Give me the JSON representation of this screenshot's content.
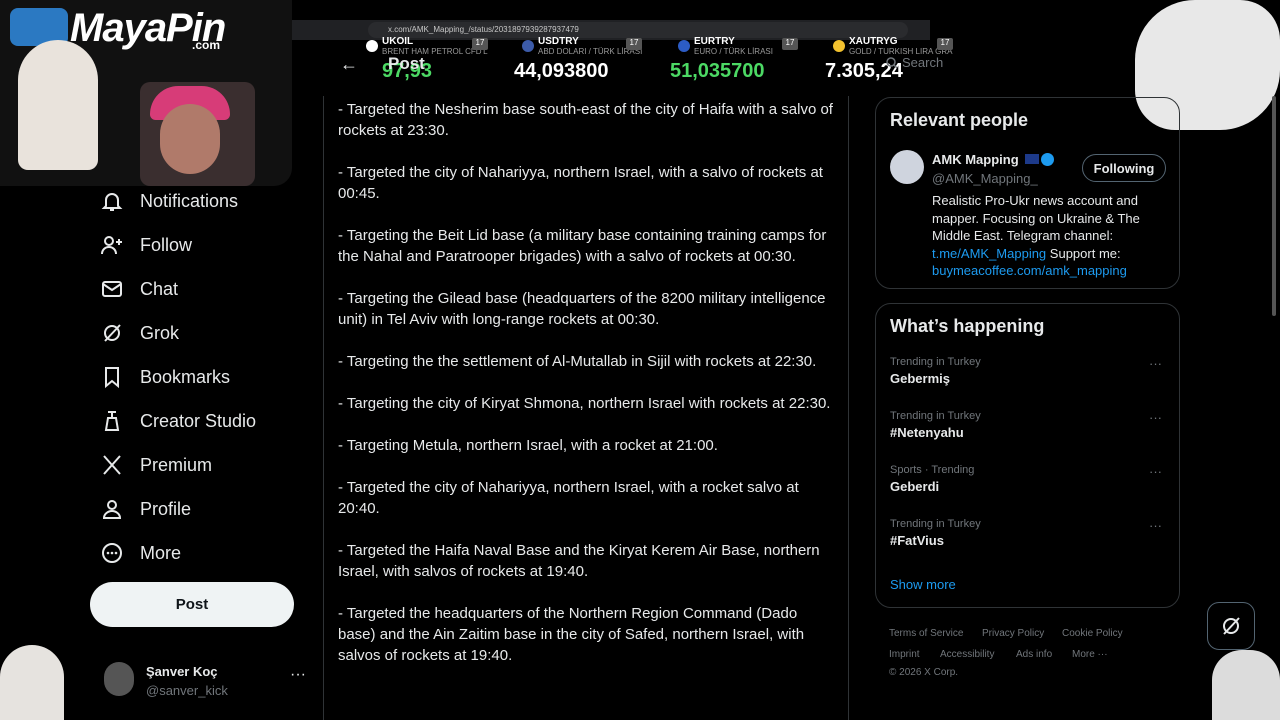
{
  "browser": {
    "url": "x.com/AMK_Mapping_/status/2031897939287937479"
  },
  "overlay": {
    "brand": "MayaPin",
    "brand_suffix": ".com"
  },
  "ticker": [
    {
      "code": "UKOIL",
      "sub": "BRENT HAM PETROL CFD'L",
      "value": "97,93",
      "color": "#4cd964"
    },
    {
      "code": "USDTRY",
      "sub": "ABD DOLARI / TÜRK LİRASI",
      "value": "44,093800",
      "color": "#ffffff"
    },
    {
      "code": "EURTRY",
      "sub": "EURO / TÜRK LİRASI",
      "value": "51,035700",
      "color": "#4cd964"
    },
    {
      "code": "XAUTRYG",
      "sub": "GOLD / TURKISH LIRA GRA",
      "value": "7.305,24",
      "color": "#ffffff"
    }
  ],
  "nav": {
    "items": [
      {
        "label": "Notifications",
        "icon": "bell-icon"
      },
      {
        "label": "Follow",
        "icon": "add-user-icon"
      },
      {
        "label": "Chat",
        "icon": "mail-icon"
      },
      {
        "label": "Grok",
        "icon": "grok-icon"
      },
      {
        "label": "Bookmarks",
        "icon": "bookmark-icon"
      },
      {
        "label": "Creator Studio",
        "icon": "creator-studio-icon"
      },
      {
        "label": "Premium",
        "icon": "x-logo-icon"
      },
      {
        "label": "Profile",
        "icon": "person-icon"
      },
      {
        "label": "More",
        "icon": "more-circle-icon"
      }
    ],
    "post_button": "Post"
  },
  "account": {
    "name": "Şanver Koç",
    "handle": "@sanver_kick",
    "more": "···"
  },
  "main": {
    "title": "Post",
    "paragraphs": [
      "- Targeted the Nesherim base south-east of the city of Haifa with a salvo of rockets at 23:30.",
      "- Targeted the city of Nahariyya, northern Israel, with a salvo of rockets at 00:45.",
      "- Targeting the Beit Lid base (a military base containing training camps for the Nahal and Paratrooper brigades) with a salvo of rockets at 00:30.",
      "- Targeting the Gilead base (headquarters of the 8200 military intelligence unit) in Tel Aviv with long-range rockets at 00:30.",
      "- Targeting the the settlement of Al-Mutallab in Sijil with rockets at 22:30.",
      "- Targeting the city of Kiryat Shmona, northern Israel with rockets at 22:30.",
      "- Targeting Metula, northern Israel, with a rocket at 21:00.",
      "- Targeted the city of Nahariyya, northern Israel, with a rocket salvo at 20:40.",
      "- Targeted the Haifa Naval Base and the Kiryat Kerem Air Base, northern Israel, with salvos of rockets at 19:40.",
      "- Targeted the headquarters of the Northern Region Command (Dado base) and the Ain Zaitim base in the city of Safed, northern Israel, with salvos of rockets at 19:40."
    ]
  },
  "search": {
    "placeholder": "Search"
  },
  "relevant_people": {
    "title": "Relevant people",
    "name": "AMK Mapping",
    "handle": "@AMK_Mapping_",
    "follow_label": "Following",
    "bio": "Realistic Pro-Ukr news account and mapper. Focusing on Ukraine & The Middle East. Telegram channel:",
    "link1": "t.me/AMK_Mapping",
    "bio_mid": "Support me:",
    "link2": "buymeacoffee.com/amk_mapping"
  },
  "whats_happening": {
    "title": "What’s happening",
    "trends": [
      {
        "context": "Trending in Turkey",
        "name": "Gebermiş"
      },
      {
        "context": "Trending in Turkey",
        "name": "#Netenyahu"
      },
      {
        "context": "Sports · Trending",
        "name": "Geberdi"
      },
      {
        "context": "Trending in Turkey",
        "name": "#FatVius"
      }
    ],
    "show_more": "Show more"
  },
  "footer": {
    "links": [
      "Terms of Service",
      "Privacy Policy",
      "Cookie Policy",
      "Imprint",
      "Accessibility",
      "Ads info",
      "More ···"
    ],
    "copyright": "© 2026 X Corp."
  }
}
